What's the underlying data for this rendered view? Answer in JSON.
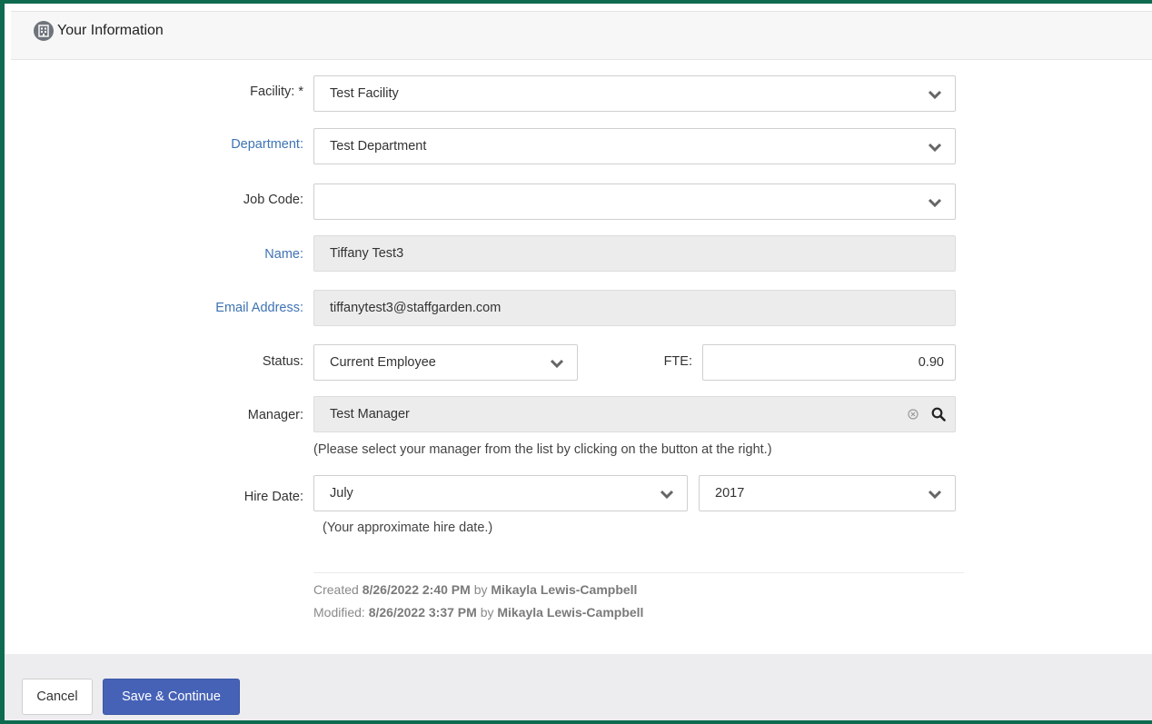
{
  "header": {
    "title": "Your Information",
    "icon": "building-icon"
  },
  "form": {
    "facility": {
      "label": "Facility: *",
      "value": "Test Facility"
    },
    "department": {
      "label": "Department:",
      "value": "Test Department"
    },
    "job_code": {
      "label": "Job Code:",
      "value": ""
    },
    "name": {
      "label": "Name:",
      "value": "Tiffany Test3"
    },
    "email": {
      "label": "Email Address:",
      "value": "tiffanytest3@staffgarden.com"
    },
    "status": {
      "label": "Status:",
      "value": "Current Employee"
    },
    "fte": {
      "label": "FTE:",
      "value": "0.90"
    },
    "manager": {
      "label": "Manager:",
      "value": "Test Manager",
      "hint": "(Please select your manager from the list by clicking on the button at the right.)"
    },
    "hire_date": {
      "label": "Hire Date:",
      "month": "July",
      "year": "2017",
      "hint": "(Your approximate hire date.)"
    }
  },
  "meta": {
    "created_prefix": "Created",
    "created_date": "8/26/2022 2:40 PM",
    "created_by_word": "by",
    "created_by": "Mikayla Lewis-Campbell",
    "modified_prefix": "Modified:",
    "modified_date": "8/26/2022 3:37 PM",
    "modified_by_word": "by",
    "modified_by": "Mikayla Lewis-Campbell"
  },
  "footer": {
    "cancel_label": "Cancel",
    "save_label": "Save & Continue"
  },
  "colors": {
    "accent": "#4662b7",
    "frame": "#0e6b50",
    "label_blue": "#3e73b3"
  }
}
